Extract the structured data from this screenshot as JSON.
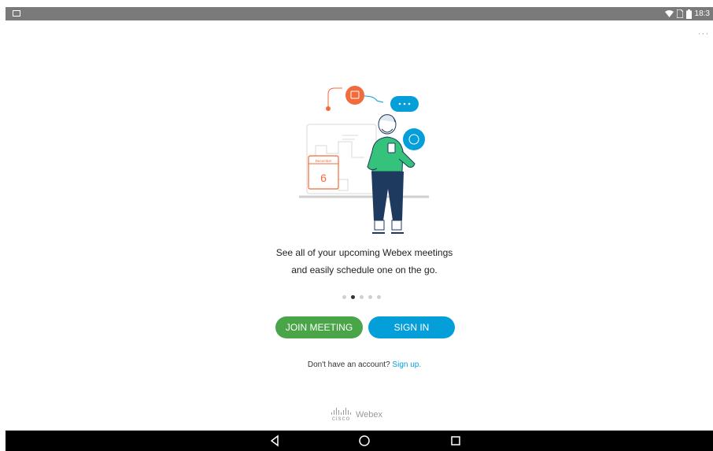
{
  "status_bar": {
    "clock": "18:3",
    "icons": [
      "image-notification-icon",
      "wifi-icon",
      "sim-icon",
      "battery-icon"
    ]
  },
  "menu": {
    "overflow_label": "···"
  },
  "illustration": {
    "calendar_month": "December",
    "calendar_day": "6"
  },
  "onboarding": {
    "caption_line1": "See all of your upcoming Webex meetings",
    "caption_line2": "and easily schedule one on the go.",
    "page_count": 5,
    "active_page": 2
  },
  "actions": {
    "join_label": "JOIN MEETING",
    "signin_label": "SIGN IN"
  },
  "signup": {
    "prompt": "Don't have an account?",
    "link": "Sign up."
  },
  "branding": {
    "company": "cisco",
    "product": "Webex"
  },
  "navigation": {
    "buttons": [
      "back-icon",
      "home-icon",
      "recents-icon"
    ]
  },
  "colors": {
    "join": "#4aa548",
    "signin": "#049fd9",
    "link": "#049fd9",
    "accent_orange": "#f26b3a",
    "accent_green": "#35c27a",
    "accent_navy": "#1e3a5f"
  }
}
